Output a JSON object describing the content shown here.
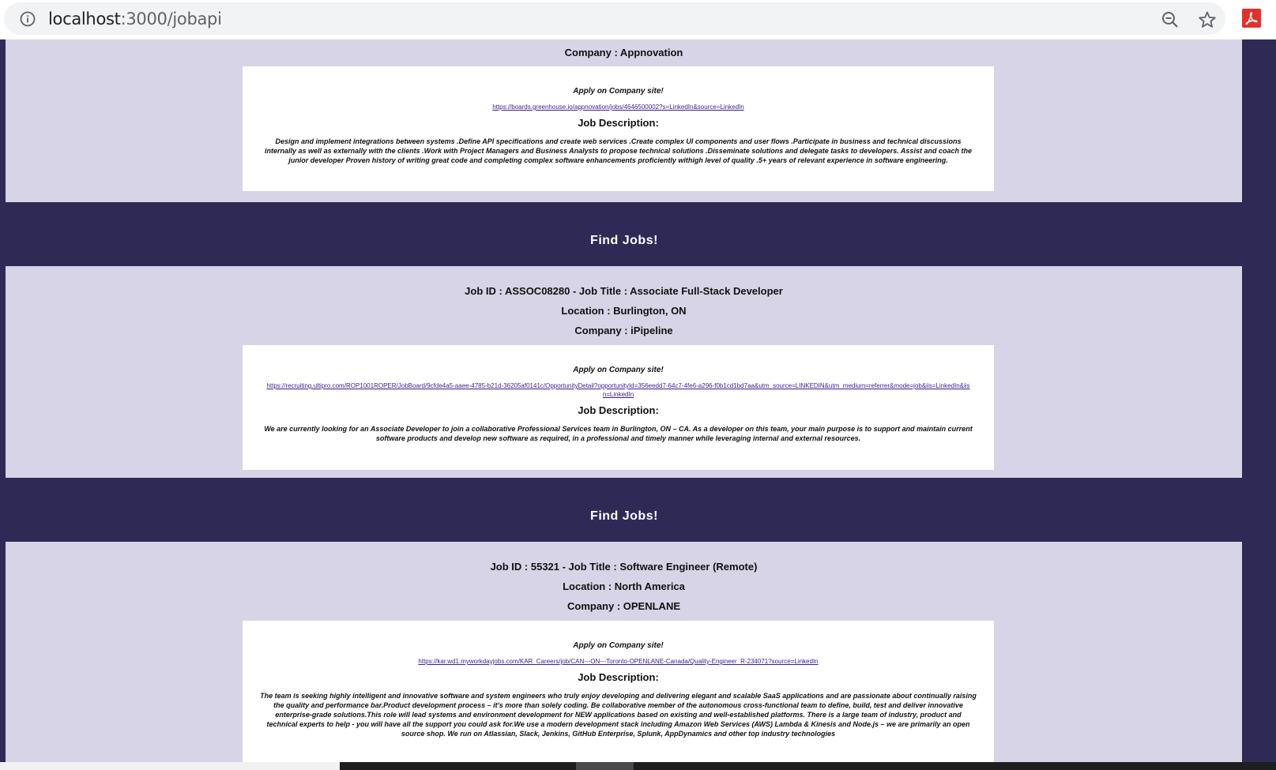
{
  "browser": {
    "url_host": "localhost",
    "url_path": ":3000/jobapi"
  },
  "page": {
    "find_heading": "Find Jobs!",
    "apply_label": "Apply on Company site!",
    "description_label": "Job Description:"
  },
  "jobs": [
    {
      "company_line": "Company : Appnovation",
      "apply_url": "https://boards.greenhouse.io/appnovation/jobs/4646500002?s=LinkedIn&source=LinkedIn",
      "description": "Design and implement integrations between systems .Define API specifications and create web services .Create complex UI components and user flows .Participate in business and technical discussions internally as well as externally with the clients .Work with Project Managers and Business Analysts to propose technical solutions .Disseminate solutions and delegate tasks to developers. Assist and coach the junior developer Proven history of writing great code and completing complex software enhancements proficiently withigh level of quality .5+ years of relevant experience in software engineering."
    },
    {
      "id_title_line": "Job ID : ASSOC08280 - Job Title : Associate Full-Stack Developer",
      "location_line": "Location : Burlington, ON",
      "company_line": "Company : iPipeline",
      "apply_url": "https://recruiting.ultipro.com/ROP1001ROPER/JobBoard/9cfde4a5-aaee-4785-b21d-36205af0141c/OpportunityDetail?opportunityId=356eedd7-64c7-4fe6-a296-f0b1cd1bd7aa&utm_source=LINKEDIN&utm_medium=referrer&mode=job&iis=LinkedIn&iisn=LinkedIn",
      "description": "We are currently looking for an Associate Developer to join a collaborative Professional Services team in Burlington, ON – CA. As a developer on this team, your main purpose is to support and maintain current software products and develop new software as required, in a professional and timely manner while leveraging internal and external resources."
    },
    {
      "id_title_line": "Job ID : 55321 - Job Title : Software Engineer (Remote)",
      "location_line": "Location : North America",
      "company_line": "Company : OPENLANE",
      "apply_url": "https://kar.wd1.myworkdayjobs.com/KAR_Careers/job/CAN---ON---Toronto-OPENLANE-Canada/Quality-Engineer_R-234071?source=LinkedIn",
      "description": "The team is seeking highly intelligent and innovative software and system engineers who truly enjoy developing and delivering elegant and scalable SaaS applications and are passionate about continually raising the quality and performance bar.Product development process – it's more than solely coding. Be collaborative member of the autonomous cross-functional team to define, build, test and deliver innovative enterprise-grade solutions.This role will lead systems and environment development for NEW applications based on existing and well-established platforms. There is a large team of industry, product and technical experts to help - you will have all the support you could ask for.We use a modern development stack including Amazon Web Services (AWS) Lambda & Kinesis and Node.js – we are primarily an open source shop. We run on Atlassian, Slack, Jenkins, GitHub Enterprise, Splunk, AppDynamics and other top industry technologies"
    }
  ]
}
